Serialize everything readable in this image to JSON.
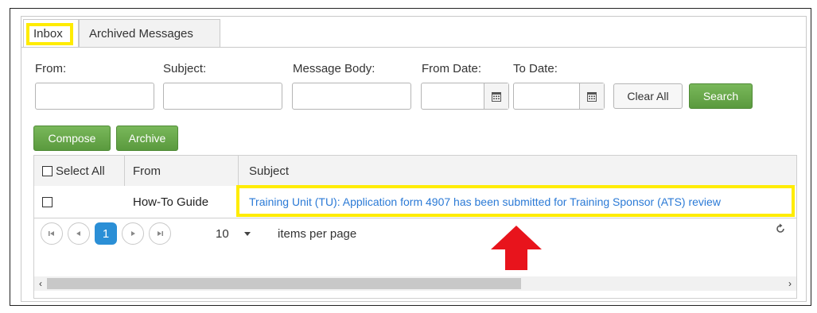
{
  "tabs": [
    {
      "label": "Inbox",
      "active": true
    },
    {
      "label": "Archived Messages",
      "active": false
    }
  ],
  "filters": {
    "from_label": "From:",
    "subject_label": "Subject:",
    "body_label": "Message Body:",
    "from_date_label": "From Date:",
    "to_date_label": "To Date:",
    "from_value": "",
    "subject_value": "",
    "body_value": "",
    "from_date_value": "",
    "to_date_value": ""
  },
  "buttons": {
    "clear_all": "Clear All",
    "search": "Search",
    "compose": "Compose",
    "archive": "Archive"
  },
  "grid": {
    "columns": [
      "Select All",
      "From",
      "Subject"
    ],
    "rows": [
      {
        "from": "How-To Guide",
        "subject": "Training Unit (TU): Application form 4907 has been submitted for Training Sponsor (ATS) review"
      }
    ]
  },
  "pager": {
    "current_page": "1",
    "page_size": "10",
    "items_per_page_label": "items per page"
  },
  "colors": {
    "highlight": "#ffec00",
    "accent_green": "#5a9a3e",
    "link_blue": "#2b7ad6",
    "annotation_arrow": "#e8141c"
  }
}
